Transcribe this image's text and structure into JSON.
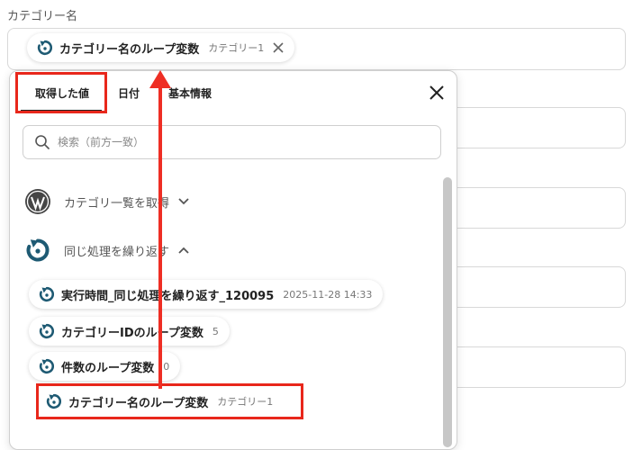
{
  "field": {
    "label": "カテゴリー名",
    "selected_chip": {
      "name": "カテゴリー名のループ変数",
      "value": "カテゴリー1"
    }
  },
  "dropdown": {
    "tabs": [
      {
        "label": "取得した値",
        "active": true
      },
      {
        "label": "日付",
        "active": false
      },
      {
        "label": "基本情報",
        "active": false
      }
    ],
    "search": {
      "placeholder": "検索（前方一致）",
      "value": ""
    },
    "sections": [
      {
        "label": "カテゴリ一覧を取得",
        "expanded": false,
        "icon": "wordpress-icon"
      },
      {
        "label": "同じ処理を繰り返す",
        "expanded": true,
        "icon": "loop-icon"
      }
    ],
    "items": [
      {
        "name": "実行時間_同じ処理を繰り返す_120095",
        "value": "2025-11-28 14:33"
      },
      {
        "name": "カテゴリーIDのループ変数",
        "value": "5"
      },
      {
        "name": "件数のループ変数",
        "value": "0"
      },
      {
        "name": "カテゴリー名のループ変数",
        "value": "カテゴリー1"
      }
    ]
  },
  "colors": {
    "accent": "#1e5a73",
    "highlight": "#e8271b",
    "border": "#d8d8d8"
  }
}
